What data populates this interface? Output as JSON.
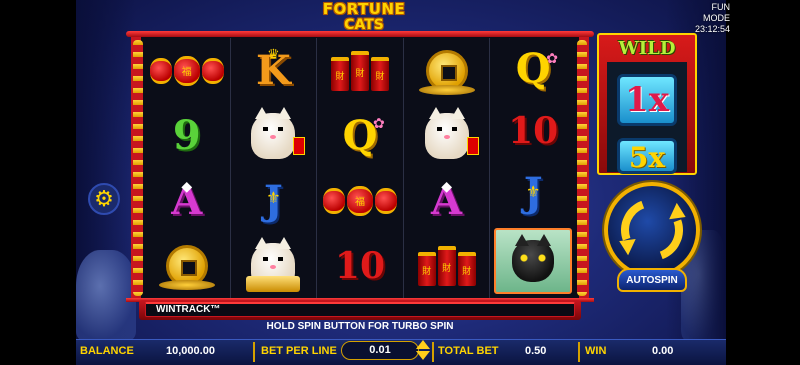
{
  "header": {
    "logo_line1": "FORTUNE",
    "logo_line2": "CATS",
    "mode": "FUN MODE",
    "time": "23:12:54"
  },
  "reels": [
    [
      "lantern",
      "9",
      "A",
      "coin"
    ],
    [
      "K",
      "lucky-cat",
      "J",
      "lucky-cat-gold"
    ],
    [
      "firecracker",
      "Q",
      "lantern",
      "10"
    ],
    [
      "coin",
      "lucky-cat",
      "A",
      "firecracker"
    ],
    [
      "Q",
      "10",
      "J",
      "black-cat"
    ]
  ],
  "symbol_text": {
    "K": "K",
    "Q": "Q",
    "J": "J",
    "A": "A",
    "nine": "9",
    "ten": "10"
  },
  "wild_panel": {
    "title": "WILD",
    "multipliers": [
      "1x",
      "5x"
    ]
  },
  "wintrack": {
    "label": "WINTRACK™"
  },
  "turbo_hint": "HOLD SPIN BUTTON FOR TURBO SPIN",
  "autospin_label": "AUTOSPIN",
  "bottom_bar": {
    "balance_label": "BALANCE",
    "balance_value": "10,000.00",
    "bet_per_line_label": "BET PER LINE",
    "bet_per_line_value": "0.01",
    "total_bet_label": "TOTAL BET",
    "total_bet_value": "0.50",
    "win_label": "WIN",
    "win_value": "0.00"
  },
  "colors": {
    "frame_red": "#c7161f",
    "gold": "#ffd400",
    "background_blue": "#1e2a78"
  }
}
